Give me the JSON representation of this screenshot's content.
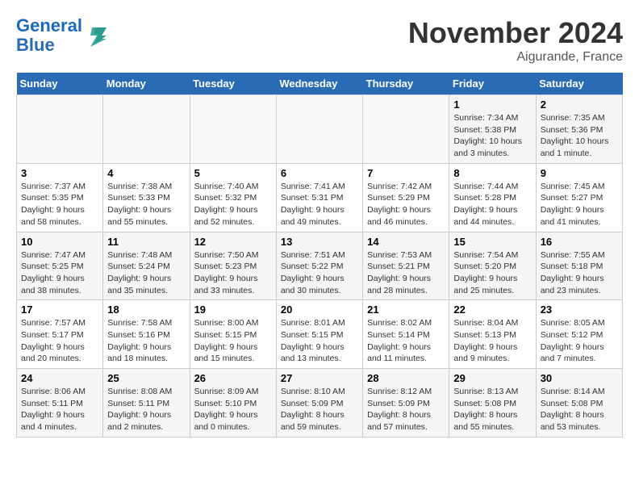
{
  "header": {
    "logo_line1": "General",
    "logo_line2": "Blue",
    "month": "November 2024",
    "location": "Aigurande, France"
  },
  "weekdays": [
    "Sunday",
    "Monday",
    "Tuesday",
    "Wednesday",
    "Thursday",
    "Friday",
    "Saturday"
  ],
  "weeks": [
    [
      {
        "day": "",
        "info": ""
      },
      {
        "day": "",
        "info": ""
      },
      {
        "day": "",
        "info": ""
      },
      {
        "day": "",
        "info": ""
      },
      {
        "day": "",
        "info": ""
      },
      {
        "day": "1",
        "info": "Sunrise: 7:34 AM\nSunset: 5:38 PM\nDaylight: 10 hours\nand 3 minutes."
      },
      {
        "day": "2",
        "info": "Sunrise: 7:35 AM\nSunset: 5:36 PM\nDaylight: 10 hours\nand 1 minute."
      }
    ],
    [
      {
        "day": "3",
        "info": "Sunrise: 7:37 AM\nSunset: 5:35 PM\nDaylight: 9 hours\nand 58 minutes."
      },
      {
        "day": "4",
        "info": "Sunrise: 7:38 AM\nSunset: 5:33 PM\nDaylight: 9 hours\nand 55 minutes."
      },
      {
        "day": "5",
        "info": "Sunrise: 7:40 AM\nSunset: 5:32 PM\nDaylight: 9 hours\nand 52 minutes."
      },
      {
        "day": "6",
        "info": "Sunrise: 7:41 AM\nSunset: 5:31 PM\nDaylight: 9 hours\nand 49 minutes."
      },
      {
        "day": "7",
        "info": "Sunrise: 7:42 AM\nSunset: 5:29 PM\nDaylight: 9 hours\nand 46 minutes."
      },
      {
        "day": "8",
        "info": "Sunrise: 7:44 AM\nSunset: 5:28 PM\nDaylight: 9 hours\nand 44 minutes."
      },
      {
        "day": "9",
        "info": "Sunrise: 7:45 AM\nSunset: 5:27 PM\nDaylight: 9 hours\nand 41 minutes."
      }
    ],
    [
      {
        "day": "10",
        "info": "Sunrise: 7:47 AM\nSunset: 5:25 PM\nDaylight: 9 hours\nand 38 minutes."
      },
      {
        "day": "11",
        "info": "Sunrise: 7:48 AM\nSunset: 5:24 PM\nDaylight: 9 hours\nand 35 minutes."
      },
      {
        "day": "12",
        "info": "Sunrise: 7:50 AM\nSunset: 5:23 PM\nDaylight: 9 hours\nand 33 minutes."
      },
      {
        "day": "13",
        "info": "Sunrise: 7:51 AM\nSunset: 5:22 PM\nDaylight: 9 hours\nand 30 minutes."
      },
      {
        "day": "14",
        "info": "Sunrise: 7:53 AM\nSunset: 5:21 PM\nDaylight: 9 hours\nand 28 minutes."
      },
      {
        "day": "15",
        "info": "Sunrise: 7:54 AM\nSunset: 5:20 PM\nDaylight: 9 hours\nand 25 minutes."
      },
      {
        "day": "16",
        "info": "Sunrise: 7:55 AM\nSunset: 5:18 PM\nDaylight: 9 hours\nand 23 minutes."
      }
    ],
    [
      {
        "day": "17",
        "info": "Sunrise: 7:57 AM\nSunset: 5:17 PM\nDaylight: 9 hours\nand 20 minutes."
      },
      {
        "day": "18",
        "info": "Sunrise: 7:58 AM\nSunset: 5:16 PM\nDaylight: 9 hours\nand 18 minutes."
      },
      {
        "day": "19",
        "info": "Sunrise: 8:00 AM\nSunset: 5:15 PM\nDaylight: 9 hours\nand 15 minutes."
      },
      {
        "day": "20",
        "info": "Sunrise: 8:01 AM\nSunset: 5:15 PM\nDaylight: 9 hours\nand 13 minutes."
      },
      {
        "day": "21",
        "info": "Sunrise: 8:02 AM\nSunset: 5:14 PM\nDaylight: 9 hours\nand 11 minutes."
      },
      {
        "day": "22",
        "info": "Sunrise: 8:04 AM\nSunset: 5:13 PM\nDaylight: 9 hours\nand 9 minutes."
      },
      {
        "day": "23",
        "info": "Sunrise: 8:05 AM\nSunset: 5:12 PM\nDaylight: 9 hours\nand 7 minutes."
      }
    ],
    [
      {
        "day": "24",
        "info": "Sunrise: 8:06 AM\nSunset: 5:11 PM\nDaylight: 9 hours\nand 4 minutes."
      },
      {
        "day": "25",
        "info": "Sunrise: 8:08 AM\nSunset: 5:11 PM\nDaylight: 9 hours\nand 2 minutes."
      },
      {
        "day": "26",
        "info": "Sunrise: 8:09 AM\nSunset: 5:10 PM\nDaylight: 9 hours\nand 0 minutes."
      },
      {
        "day": "27",
        "info": "Sunrise: 8:10 AM\nSunset: 5:09 PM\nDaylight: 8 hours\nand 59 minutes."
      },
      {
        "day": "28",
        "info": "Sunrise: 8:12 AM\nSunset: 5:09 PM\nDaylight: 8 hours\nand 57 minutes."
      },
      {
        "day": "29",
        "info": "Sunrise: 8:13 AM\nSunset: 5:08 PM\nDaylight: 8 hours\nand 55 minutes."
      },
      {
        "day": "30",
        "info": "Sunrise: 8:14 AM\nSunset: 5:08 PM\nDaylight: 8 hours\nand 53 minutes."
      }
    ]
  ]
}
